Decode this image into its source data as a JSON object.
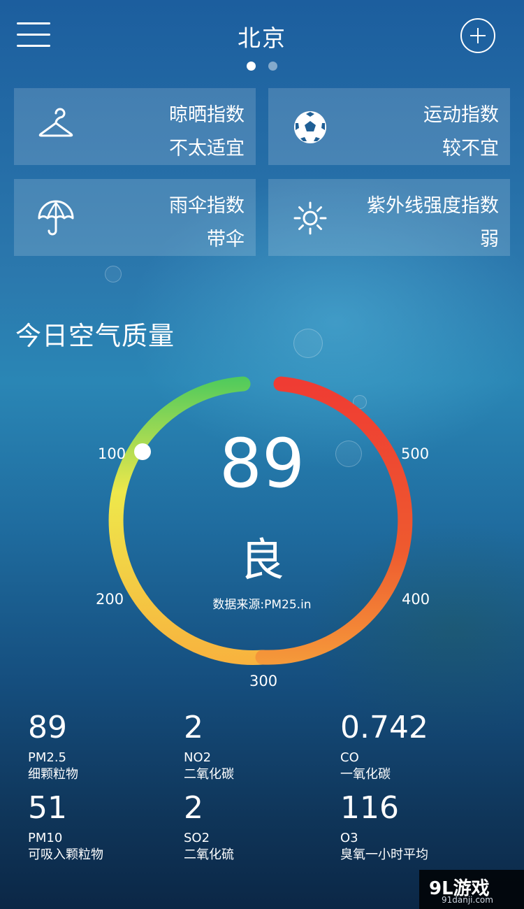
{
  "header": {
    "title": "北京",
    "page_count": 2,
    "active_page": 1
  },
  "indices": [
    {
      "label": "晾晒指数",
      "value": "不太适宜",
      "icon": "hanger-icon"
    },
    {
      "label": "运动指数",
      "value": "较不宜",
      "icon": "soccer-ball-icon"
    },
    {
      "label": "雨伞指数",
      "value": "带伞",
      "icon": "umbrella-icon"
    },
    {
      "label": "紫外线强度指数",
      "value": "弱",
      "icon": "sun-icon"
    }
  ],
  "air_quality": {
    "title": "今日空气质量",
    "aqi": "89",
    "grade": "良",
    "source": "数据来源:PM25.in",
    "scale_labels": {
      "t100": "100",
      "t200": "200",
      "t300": "300",
      "t400": "400",
      "t500": "500"
    },
    "gauge_colors": [
      "#58c95a",
      "#f4e14a",
      "#f7a93c",
      "#ee4a32"
    ]
  },
  "pollutants": [
    {
      "value": "89",
      "name": "PM2.5",
      "desc": "细颗粒物"
    },
    {
      "value": "2",
      "name": "NO2",
      "desc": "二氧化碳"
    },
    {
      "value": "0.742",
      "name": "CO",
      "desc": "一氧化碳"
    },
    {
      "value": "51",
      "name": "PM10",
      "desc": "可吸入颗粒物"
    },
    {
      "value": "2",
      "name": "SO2",
      "desc": "二氧化硫"
    },
    {
      "value": "116",
      "name": "O3",
      "desc": "臭氧一小时平均"
    }
  ],
  "watermark": {
    "main": "9L游戏",
    "sub": "91danji.com"
  }
}
